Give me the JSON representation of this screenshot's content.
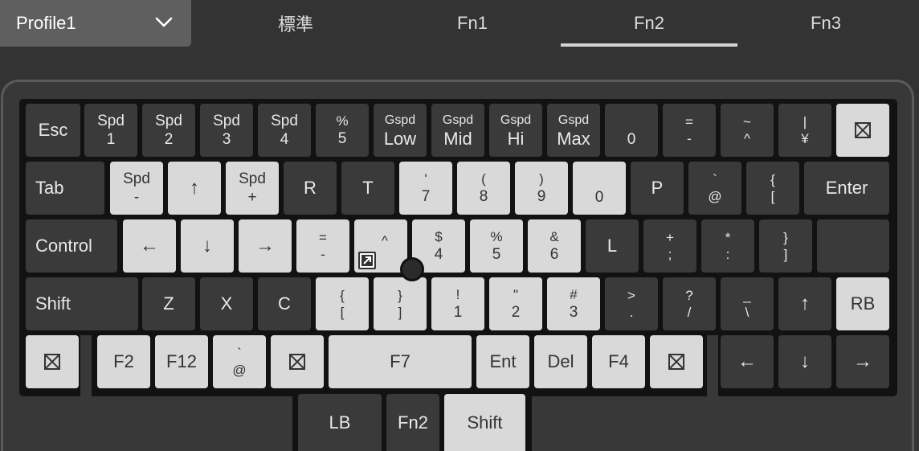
{
  "profile": {
    "label": "Profile1"
  },
  "tabs": [
    {
      "label": "標準",
      "active": false
    },
    {
      "label": "Fn1",
      "active": false
    },
    {
      "label": "Fn2",
      "active": true
    },
    {
      "label": "Fn3",
      "active": false
    }
  ],
  "keyboard": {
    "row1": {
      "esc": "Esc",
      "spd1": [
        "Spd",
        "1"
      ],
      "spd2": [
        "Spd",
        "2"
      ],
      "spd3": [
        "Spd",
        "3"
      ],
      "spd4": [
        "Spd",
        "4"
      ],
      "k5": [
        "%",
        "5"
      ],
      "gspd_low": [
        "Gspd",
        "Low"
      ],
      "gspd_mid": [
        "Gspd",
        "Mid"
      ],
      "gspd_hi": [
        "Gspd",
        "Hi"
      ],
      "gspd_max": [
        "Gspd",
        "Max"
      ],
      "k0": "0",
      "minus": [
        "=",
        "-"
      ],
      "caret": [
        "~",
        "^"
      ],
      "yen": [
        "|",
        "¥"
      ]
    },
    "row2": {
      "tab": "Tab",
      "spd_minus": [
        "Spd",
        "-"
      ],
      "up": "↑",
      "spd_plus": [
        "Spd",
        "+"
      ],
      "r": "R",
      "t": "T",
      "k7": [
        "'",
        "7"
      ],
      "k8": [
        "(",
        "8"
      ],
      "k9": [
        ")",
        "9"
      ],
      "k0": "0",
      "p": "P",
      "at": [
        "`",
        "@"
      ],
      "bracket": [
        "{",
        "["
      ],
      "enter": "Enter"
    },
    "row3": {
      "control": "Control",
      "left": "←",
      "down": "↓",
      "right": "→",
      "minus": [
        "=",
        "-"
      ],
      "caret": "^",
      "k4": [
        "$",
        "4"
      ],
      "k5": [
        "%",
        "5"
      ],
      "k6": [
        "&",
        "6"
      ],
      "l": "L",
      "semicolon": [
        "+",
        ";"
      ],
      "colon": [
        "*",
        ":"
      ],
      "rbracket": [
        "}",
        "]"
      ]
    },
    "row4": {
      "shift": "Shift",
      "z": "Z",
      "x": "X",
      "c": "C",
      "lbracket": [
        "{",
        "["
      ],
      "rbracket": [
        "}",
        "]"
      ],
      "k1": [
        "!",
        "1"
      ],
      "k2": [
        "\"",
        "2"
      ],
      "k3": [
        "#",
        "3"
      ],
      "period": [
        ">",
        "."
      ],
      "slash": [
        "?",
        "/"
      ],
      "backslash": [
        "_",
        "\\"
      ],
      "up": "↑",
      "rb": "RB"
    },
    "row5": {
      "f2": "F2",
      "f12": "F12",
      "at": [
        "`",
        "@"
      ],
      "f7": "F7",
      "ent": "Ent",
      "del": "Del",
      "f4": "F4",
      "left": "←",
      "down": "↓",
      "right": "→"
    },
    "row6": {
      "lb": "LB",
      "fn2": "Fn2",
      "shift": "Shift"
    }
  }
}
